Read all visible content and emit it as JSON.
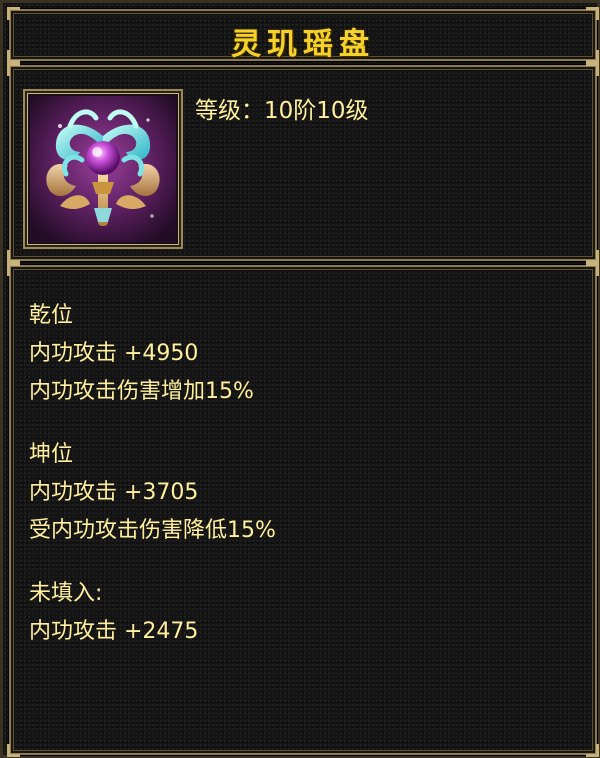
{
  "item": {
    "name": "灵玑瑶盘",
    "level_label": "等级：",
    "level_value": "10阶10级"
  },
  "stat_groups": [
    {
      "header": "乾位",
      "lines": [
        "内功攻击 +4950",
        "内功攻击伤害增加15%"
      ]
    },
    {
      "header": "坤位",
      "lines": [
        "内功攻击 +3705",
        "受内功攻击伤害降低15%"
      ]
    },
    {
      "header": "未填入:",
      "lines": [
        "内功攻击 +2475"
      ]
    }
  ],
  "colors": {
    "title": "#f5d22a",
    "text": "#ffef9e",
    "border": "#8a7a55",
    "background": "#151515"
  },
  "icon": {
    "name": "ornate-jade-disc-icon"
  }
}
